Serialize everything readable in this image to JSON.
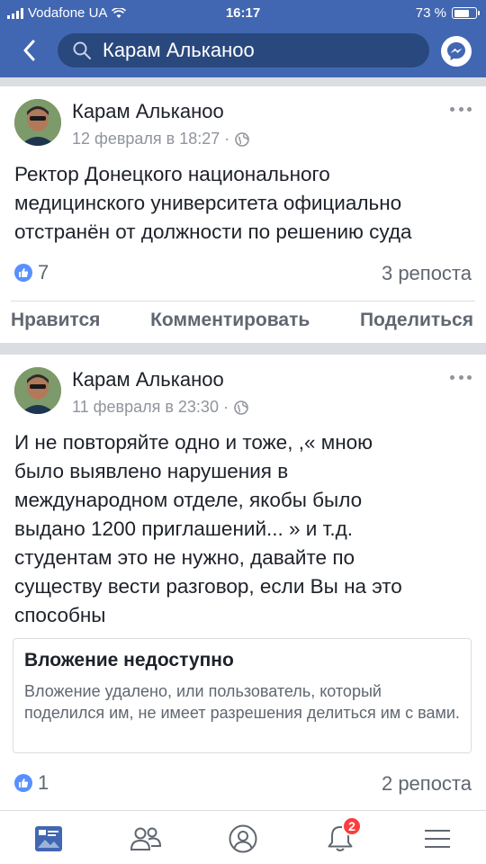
{
  "status_bar": {
    "carrier": "Vodafone UA",
    "time": "16:17",
    "battery_percent": "73 %",
    "battery_level": 0.73
  },
  "header": {
    "search_value": "Карам Альканоо",
    "back_icon": "chevron-left-icon",
    "messenger_icon": "messenger-icon"
  },
  "colors": {
    "brand": "#4267b2",
    "search_bg": "#29487d",
    "like_blue": "#5890ff",
    "badge_red": "#fa3e3e"
  },
  "posts": [
    {
      "author": "Карам Альканоо",
      "date": "12 февраля в 18:27 ·",
      "text": "Ректор Донецкого национального\nмедицинского университета официально\nотстранён от должности по решению суда",
      "likes": "7",
      "shares": "3 репоста",
      "actions": [
        "Нравится",
        "Комментировать",
        "Поделиться"
      ]
    },
    {
      "author": "Карам Альканоо",
      "date": "11 февраля в 23:30 ·",
      "text": "И не повторяйте одно и тоже,  ,« мною\nбыло выявлено нарушения в\nмеждународном отделе, якобы было\nвыдано 1200 приглашений... » и т.д.\nстудентам это не нужно, давайте по\nсуществу вести разговор, если Вы на это\nспособны",
      "attachment": {
        "title": "Вложение недоступно",
        "body": "Вложение удалено, или пользователь, который поделился им, не имеет разрешения делиться им с вами."
      },
      "likes": "1",
      "shares": "2 репоста"
    }
  ],
  "tabbar": {
    "notifications_count": "2",
    "tabs": [
      "news-feed-icon",
      "friends-icon",
      "profile-icon",
      "notifications-icon",
      "menu-icon"
    ]
  }
}
